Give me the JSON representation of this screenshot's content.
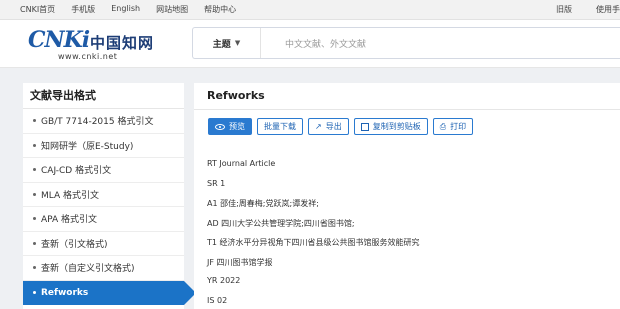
{
  "topbar": {
    "links": [
      "CNKI首页",
      "手机版",
      "English",
      "网站地图",
      "帮助中心"
    ],
    "right": [
      "旧版",
      "使用手"
    ]
  },
  "header": {
    "logo_mark": "CNKi",
    "logo_cn": "中国知网",
    "logo_url": "www.cnki.net",
    "search_scope": "主题",
    "search_placeholder": "中文文献、外文文献"
  },
  "sidebar": {
    "title": "文献导出格式",
    "items": [
      {
        "label": "GB/T 7714-2015 格式引文",
        "active": false
      },
      {
        "label": "知网研学（原E-Study)",
        "active": false
      },
      {
        "label": "CAJ-CD 格式引文",
        "active": false
      },
      {
        "label": "MLA 格式引文",
        "active": false
      },
      {
        "label": "APA 格式引文",
        "active": false
      },
      {
        "label": "查新（引文格式)",
        "active": false
      },
      {
        "label": "查新（自定义引文格式)",
        "active": false
      },
      {
        "label": "Refworks",
        "active": true
      }
    ]
  },
  "panel": {
    "title": "Refworks",
    "buttons": {
      "preview": "预览",
      "batch_download": "批量下载",
      "export": "导出",
      "copy": "复制到剪贴板",
      "print": "打印"
    },
    "lines": [
      "RT Journal Article",
      "SR 1",
      "A1 邵佳;周春梅;党跃岚;谭发祥;",
      "AD 四川大学公共管理学院;四川省图书馆;",
      "T1 经济水平分异视角下四川省县级公共图书馆服务效能研究",
      "JF 四川图书馆学报",
      "YR 2022",
      "IS 02"
    ]
  }
}
